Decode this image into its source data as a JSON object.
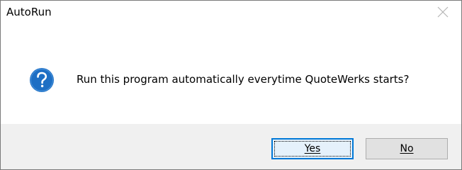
{
  "window": {
    "title": "AutoRun",
    "close_icon": "close-icon"
  },
  "message": {
    "icon": "question-icon",
    "icon_color": "#1e6fc4",
    "text": "Run this program automatically everytime QuoteWerks starts?"
  },
  "buttons": {
    "yes_label": "Yes",
    "no_label": "No",
    "default": "Yes"
  },
  "colors": {
    "focus_border": "#0078d7",
    "footer_bg": "#f0f0f0"
  }
}
